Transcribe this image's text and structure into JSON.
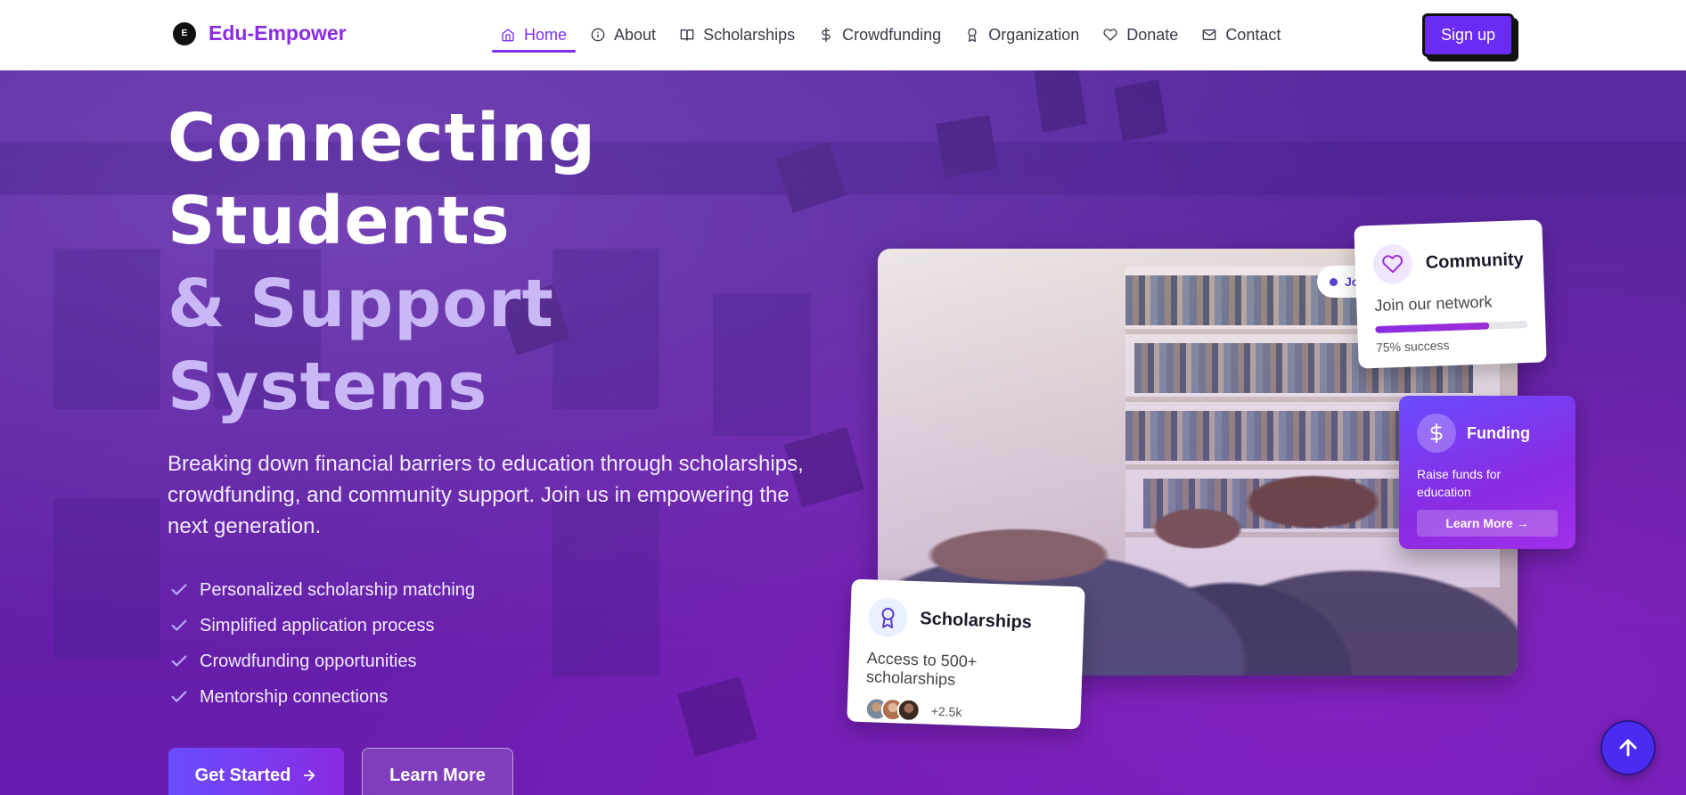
{
  "brand": {
    "name": "Edu-Empower",
    "logo_glyph": "E"
  },
  "nav": {
    "items": [
      {
        "label": "Home",
        "icon": "home-icon",
        "active": true
      },
      {
        "label": "About",
        "icon": "info-icon",
        "active": false
      },
      {
        "label": "Scholarships",
        "icon": "book-icon",
        "active": false
      },
      {
        "label": "Crowdfunding",
        "icon": "dollar-icon",
        "active": false
      },
      {
        "label": "Organization",
        "icon": "award-icon",
        "active": false
      },
      {
        "label": "Donate",
        "icon": "heart-icon",
        "active": false
      },
      {
        "label": "Contact",
        "icon": "mail-icon",
        "active": false
      }
    ],
    "signup_label": "Sign up"
  },
  "hero": {
    "title_line1": "Connecting",
    "title_line2": "Students",
    "title_line3": "& Support",
    "title_line4": "Systems",
    "subtitle": "Breaking down financial barriers to education through scholarships, crowdfunding, and community support. Join us in empowering the next generation.",
    "features": [
      "Personalized scholarship matching",
      "Simplified application process",
      "Crowdfunding opportunities",
      "Mentorship connections"
    ],
    "primary_button": "Get Started",
    "secondary_button": "Learn More"
  },
  "cards": {
    "join_pill": "Jo",
    "community": {
      "title": "Community",
      "subtitle": "Join our network",
      "progress_fraction": 0.75,
      "footer": "75% success"
    },
    "funding": {
      "title": "Funding",
      "description": "Raise funds for education",
      "button": "Learn More →"
    },
    "scholarships": {
      "title": "Scholarships",
      "subtitle": "Access to 500+ scholarships",
      "count": "+2.5k"
    }
  },
  "colors": {
    "accent": "#7b2ff7",
    "brand": "#8a2be2",
    "signup_bg": "#6a2cf5",
    "scroll_top_bg": "#4b2bf0"
  }
}
